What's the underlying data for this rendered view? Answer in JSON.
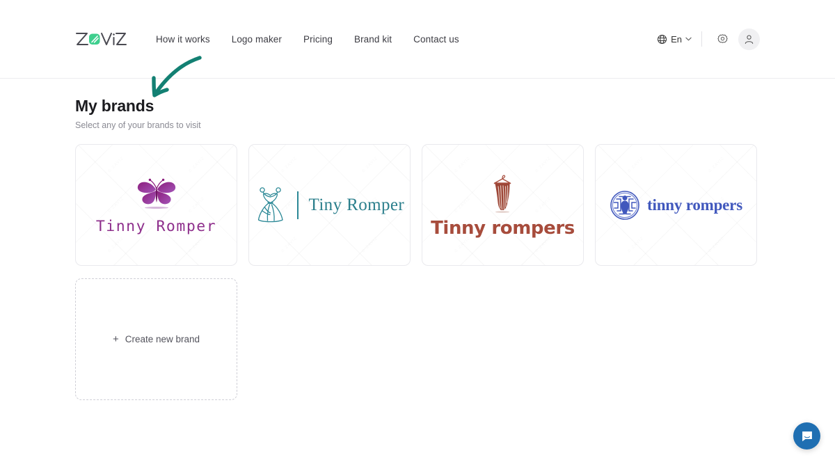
{
  "header": {
    "logo_text": "ZAVIZ",
    "logo_icon": "zaviz-mark",
    "nav": [
      {
        "label": "How it works"
      },
      {
        "label": "Logo maker"
      },
      {
        "label": "Pricing"
      },
      {
        "label": "Brand kit"
      },
      {
        "label": "Contact us"
      }
    ],
    "language": {
      "icon": "globe-icon",
      "label": "En",
      "chevron": "chevron-down-icon"
    },
    "settings_icon": "gear-icon",
    "account_icon": "user-avatar-icon"
  },
  "main": {
    "title": "My brands",
    "subtitle": "Select any of your brands to visit",
    "watermark_text": "© ZAVIZ",
    "brands": [
      {
        "name": "Tinny Romper",
        "icon": "butterfly-icon",
        "color": "#8e2f8c",
        "layout": "stacked"
      },
      {
        "name": "Tiny Romper",
        "icon": "dress-icon",
        "color": "#2b7f8c",
        "layout": "horizontal"
      },
      {
        "name": "Tinny rompers",
        "icon": "hanger-garment-icon",
        "color": "#a74c3c",
        "layout": "stacked"
      },
      {
        "name": "tinny rompers",
        "icon": "labyrinth-baby-icon",
        "color": "#4158bd",
        "layout": "horizontal"
      }
    ],
    "create_new": {
      "plus": "+",
      "label": "Create new brand"
    }
  },
  "annotation": {
    "type": "arrow",
    "color": "#138073",
    "points_to": "brand-card-1"
  },
  "chat": {
    "icon": "chat-bubble-icon",
    "color": "#1f6fb2"
  }
}
